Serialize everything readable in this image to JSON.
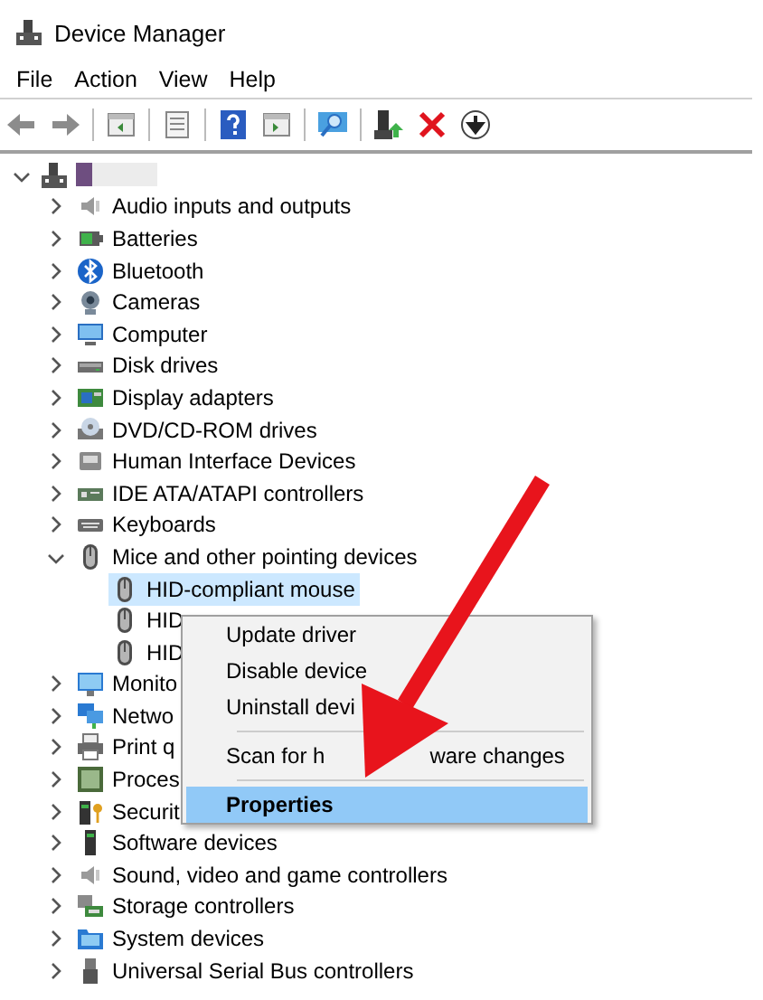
{
  "window": {
    "title": "Device Manager"
  },
  "menu_bar": [
    "File",
    "Action",
    "View",
    "Help"
  ],
  "tree": {
    "root": {
      "expanded": true
    },
    "categories": [
      {
        "label": "Audio inputs and outputs",
        "expanded": false
      },
      {
        "label": "Batteries",
        "expanded": false
      },
      {
        "label": "Bluetooth",
        "expanded": false
      },
      {
        "label": "Cameras",
        "expanded": false
      },
      {
        "label": "Computer",
        "expanded": false
      },
      {
        "label": "Disk drives",
        "expanded": false
      },
      {
        "label": "Display adapters",
        "expanded": false
      },
      {
        "label": "DVD/CD-ROM drives",
        "expanded": false
      },
      {
        "label": "Human Interface Devices",
        "expanded": false
      },
      {
        "label": "IDE ATA/ATAPI controllers",
        "expanded": false
      },
      {
        "label": "Keyboards",
        "expanded": false
      },
      {
        "label": "Mice and other pointing devices",
        "expanded": true,
        "children": [
          {
            "label": "HID-compliant mouse",
            "selected": true
          },
          {
            "label": "HID",
            "selected": false
          },
          {
            "label": "HID",
            "selected": false
          }
        ]
      },
      {
        "label": "Monito",
        "expanded": false
      },
      {
        "label": "Netwo",
        "expanded": false
      },
      {
        "label": "Print q",
        "expanded": false
      },
      {
        "label": "Proces",
        "expanded": false
      },
      {
        "label": "Securit",
        "expanded": false
      },
      {
        "label": "Software devices",
        "expanded": false
      },
      {
        "label": "Sound, video and game controllers",
        "expanded": false
      },
      {
        "label": "Storage controllers",
        "expanded": false
      },
      {
        "label": "System devices",
        "expanded": false
      },
      {
        "label": "Universal Serial Bus controllers",
        "expanded": false
      }
    ]
  },
  "context_menu": {
    "items": [
      {
        "kind": "item",
        "label": "Update driver",
        "selected": false
      },
      {
        "kind": "item",
        "label": "Disable device",
        "selected": false
      },
      {
        "kind": "item",
        "label": "Uninstall devi",
        "selected": false
      },
      {
        "kind": "separator"
      },
      {
        "kind": "item",
        "label": "Scan for h",
        "label_rest": "ware changes",
        "selected": false
      },
      {
        "kind": "separator"
      },
      {
        "kind": "item",
        "label": "Properties",
        "selected": true
      }
    ]
  }
}
